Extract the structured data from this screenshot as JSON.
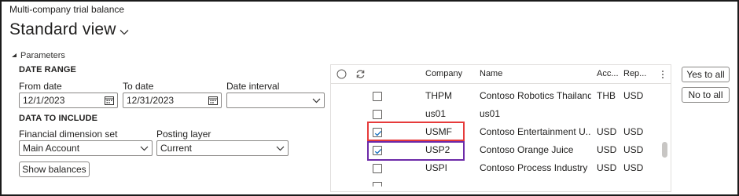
{
  "page": {
    "title": "Multi-company trial balance",
    "view_name": "Standard view",
    "params_label": "Parameters"
  },
  "date_range": {
    "section_label": "DATE RANGE",
    "from_label": "From date",
    "from_value": "12/1/2023",
    "to_label": "To date",
    "to_value": "12/31/2023",
    "interval_label": "Date interval",
    "interval_value": ""
  },
  "data_to_include": {
    "section_label": "DATA TO INCLUDE",
    "dimension_set_label": "Financial dimension set",
    "dimension_set_value": "Main Account",
    "posting_layer_label": "Posting layer",
    "posting_layer_value": "Current"
  },
  "actions": {
    "show_balances": "Show balances",
    "yes_to_all": "Yes to all",
    "no_to_all": "No to all"
  },
  "grid": {
    "columns": {
      "company": "Company",
      "name": "Name",
      "accounting_currency": "Acc...",
      "reporting_currency": "Rep..."
    },
    "rows": [
      {
        "company": "THPM",
        "name": "Contoso Robotics Thailand",
        "acc": "THB",
        "rep": "USD",
        "checked": false
      },
      {
        "company": "us01",
        "name": "us01",
        "acc": "",
        "rep": "",
        "checked": false
      },
      {
        "company": "USMF",
        "name": "Contoso Entertainment U...",
        "acc": "USD",
        "rep": "USD",
        "checked": true
      },
      {
        "company": "USP2",
        "name": "Contoso Orange Juice",
        "acc": "USD",
        "rep": "USD",
        "checked": true
      },
      {
        "company": "USPI",
        "name": "Contoso Process Industry",
        "acc": "USD",
        "rep": "USD",
        "checked": false
      }
    ]
  },
  "colors": {
    "highlight_red": "#e63b3b",
    "highlight_purple": "#6d2aa8",
    "checkbox_check": "#0f6cbd"
  }
}
